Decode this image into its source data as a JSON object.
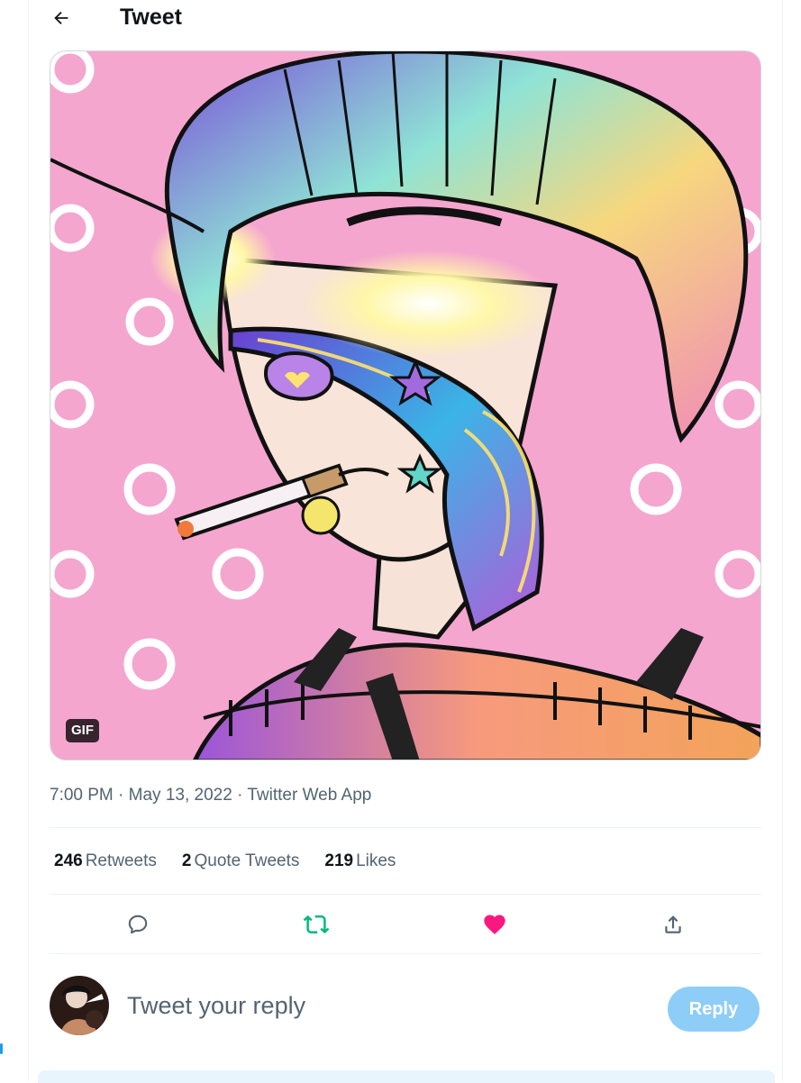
{
  "header": {
    "title": "Tweet"
  },
  "media": {
    "badge": "GIF"
  },
  "meta": {
    "time": "7:00 PM",
    "date": "May 13, 2022",
    "source": "Twitter Web App"
  },
  "stats": [
    {
      "count": "246",
      "label": "Retweets"
    },
    {
      "count": "2",
      "label": "Quote Tweets"
    },
    {
      "count": "219",
      "label": "Likes"
    }
  ],
  "actions": {
    "icons": [
      "reply-icon",
      "retweet-icon",
      "like-icon",
      "share-icon"
    ],
    "colors": {
      "retweet": "#00ba7c",
      "like": "#f91880",
      "default": "#536471"
    }
  },
  "reply": {
    "placeholder": "Tweet your reply",
    "button_label": "Reply"
  },
  "colors": {
    "accent": "#1d9bf0",
    "reply_button_disabled": "#8ecdf8"
  }
}
